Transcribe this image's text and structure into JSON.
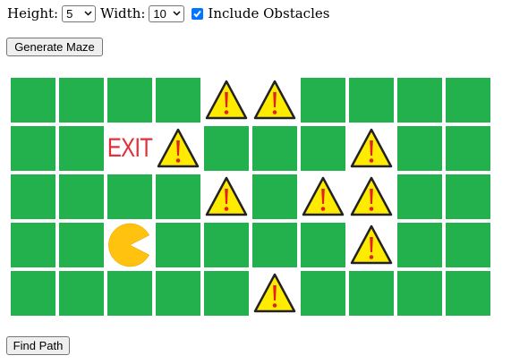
{
  "controls": {
    "height_label": "Height:",
    "height_value": "5",
    "width_label": "Width:",
    "width_value": "10",
    "obstacles_label": "Include Obstacles",
    "obstacles_checked": true
  },
  "buttons": {
    "generate": "Generate Maze",
    "find": "Find Path"
  },
  "maze": {
    "rows": 5,
    "cols": 10,
    "exit_text": "EXIT",
    "cell_color": "#22b14c",
    "grid": [
      [
        "open",
        "open",
        "open",
        "open",
        "obstacle",
        "obstacle",
        "open",
        "open",
        "open",
        "open"
      ],
      [
        "open",
        "open",
        "exit",
        "obstacle",
        "open",
        "open",
        "open",
        "obstacle",
        "open",
        "open"
      ],
      [
        "open",
        "open",
        "open",
        "open",
        "obstacle",
        "open",
        "obstacle",
        "obstacle",
        "open",
        "open"
      ],
      [
        "open",
        "open",
        "player",
        "open",
        "open",
        "open",
        "open",
        "obstacle",
        "open",
        "open"
      ],
      [
        "open",
        "open",
        "open",
        "open",
        "open",
        "obstacle",
        "open",
        "open",
        "open",
        "open"
      ]
    ]
  }
}
